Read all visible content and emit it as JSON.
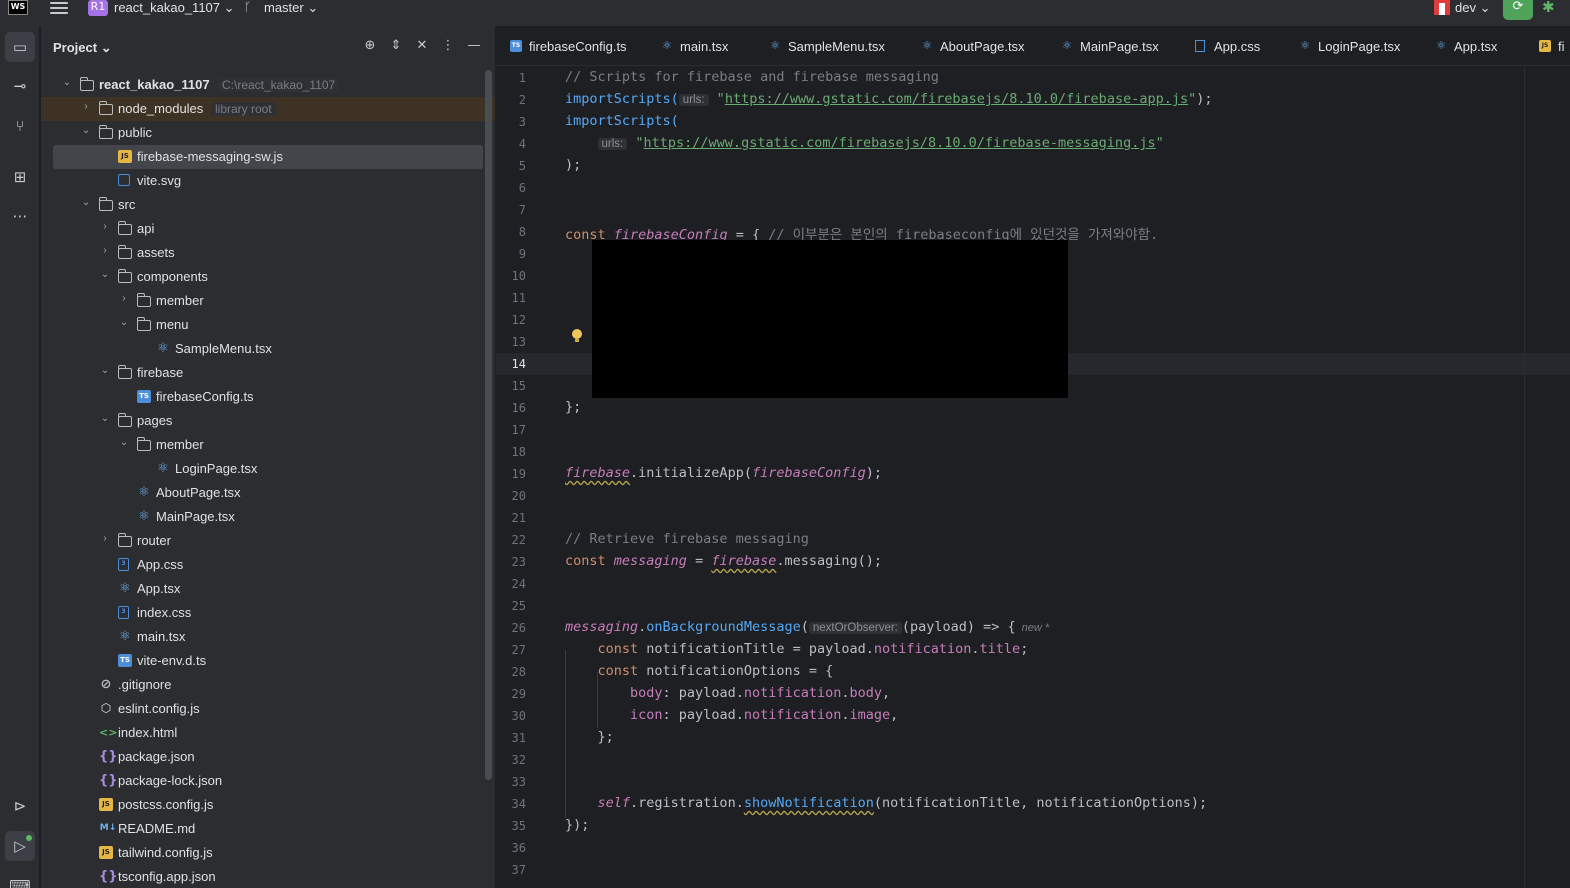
{
  "topbar": {
    "app_icon": "WS",
    "project_badge": "R1",
    "project_name": "react_kakao_1107",
    "branch": "master",
    "run_config": "dev",
    "icons": {
      "menu": "hamburger-icon",
      "branch": "git-branch-icon",
      "run": "run-icon",
      "debug": "debug-icon"
    }
  },
  "toolstrip": {
    "items": [
      "folder-icon",
      "commit-icon",
      "pull-request-icon",
      "structure-icon",
      "more-icon",
      "services-icon",
      "run-icon",
      "terminal-icon"
    ]
  },
  "project_panel": {
    "title": "Project",
    "header_icons": [
      "locate-icon",
      "expand-all-icon",
      "collapse-all-icon",
      "options-icon",
      "hide-icon"
    ],
    "tree": [
      {
        "label": "react_kakao_1107",
        "hint": "C:\\react_kakao_1107",
        "type": "folder",
        "depth": 0,
        "expanded": true,
        "bold": true
      },
      {
        "label": "node_modules",
        "hint": "library root",
        "type": "folder",
        "depth": 1,
        "expanded": false,
        "highlight": "nm"
      },
      {
        "label": "public",
        "type": "folder",
        "depth": 1,
        "expanded": true
      },
      {
        "label": "firebase-messaging-sw.js",
        "type": "js",
        "depth": 2,
        "highlight": "sel"
      },
      {
        "label": "vite.svg",
        "type": "svg",
        "depth": 2
      },
      {
        "label": "src",
        "type": "folder",
        "depth": 1,
        "expanded": true
      },
      {
        "label": "api",
        "type": "folder",
        "depth": 2,
        "expanded": false
      },
      {
        "label": "assets",
        "type": "folder",
        "depth": 2,
        "expanded": false
      },
      {
        "label": "components",
        "type": "folder",
        "depth": 2,
        "expanded": true
      },
      {
        "label": "member",
        "type": "folder",
        "depth": 3,
        "expanded": false
      },
      {
        "label": "menu",
        "type": "folder",
        "depth": 3,
        "expanded": true
      },
      {
        "label": "SampleMenu.tsx",
        "type": "react",
        "depth": 4
      },
      {
        "label": "firebase",
        "type": "folder",
        "depth": 2,
        "expanded": true
      },
      {
        "label": "firebaseConfig.ts",
        "type": "ts",
        "depth": 3
      },
      {
        "label": "pages",
        "type": "folder",
        "depth": 2,
        "expanded": true
      },
      {
        "label": "member",
        "type": "folder",
        "depth": 3,
        "expanded": true
      },
      {
        "label": "LoginPage.tsx",
        "type": "react",
        "depth": 4
      },
      {
        "label": "AboutPage.tsx",
        "type": "react",
        "depth": 3
      },
      {
        "label": "MainPage.tsx",
        "type": "react",
        "depth": 3
      },
      {
        "label": "router",
        "type": "folder",
        "depth": 2,
        "expanded": false
      },
      {
        "label": "App.css",
        "type": "css",
        "depth": 2
      },
      {
        "label": "App.tsx",
        "type": "react",
        "depth": 2
      },
      {
        "label": "index.css",
        "type": "css",
        "depth": 2
      },
      {
        "label": "main.tsx",
        "type": "react",
        "depth": 2
      },
      {
        "label": "vite-env.d.ts",
        "type": "ts",
        "depth": 2
      },
      {
        "label": ".gitignore",
        "type": "gitignore",
        "depth": 1
      },
      {
        "label": "eslint.config.js",
        "type": "eslint",
        "depth": 1
      },
      {
        "label": "index.html",
        "type": "html",
        "depth": 1
      },
      {
        "label": "package.json",
        "type": "json",
        "depth": 1
      },
      {
        "label": "package-lock.json",
        "type": "json",
        "depth": 1
      },
      {
        "label": "postcss.config.js",
        "type": "js",
        "depth": 1
      },
      {
        "label": "README.md",
        "type": "md",
        "depth": 1
      },
      {
        "label": "tailwind.config.js",
        "type": "js",
        "depth": 1
      },
      {
        "label": "tsconfig.app.json",
        "type": "json",
        "depth": 1
      }
    ]
  },
  "editor": {
    "tabs": [
      {
        "label": "firebaseConfig.ts",
        "type": "ts"
      },
      {
        "label": "main.tsx",
        "type": "react"
      },
      {
        "label": "SampleMenu.tsx",
        "type": "react"
      },
      {
        "label": "AboutPage.tsx",
        "type": "react"
      },
      {
        "label": "MainPage.tsx",
        "type": "react"
      },
      {
        "label": "App.css",
        "type": "css"
      },
      {
        "label": "LoginPage.tsx",
        "type": "react"
      },
      {
        "label": "App.tsx",
        "type": "react"
      },
      {
        "label": "fi",
        "type": "js",
        "active": true
      }
    ],
    "current_line": 14,
    "line_count": 37,
    "lines": {
      "1": "// Scripts for firebase and firebase messaging",
      "2a": "importScripts(",
      "2hint": "urls:",
      "2url": "https://www.gstatic.com/firebasejs/8.10.0/firebase-app.js",
      "3": "importScripts(",
      "4hint": "urls:",
      "4url": "https://www.gstatic.com/firebasejs/8.10.0/firebase-messaging.js",
      "5": ");",
      "8kw": "const",
      "8var": "firebaseConfig",
      "8op": " = { ",
      "8cmt1": "// 이부분은 본인의 ",
      "8cmt2": "firebaseconfig",
      "8cmt3": "에 있던것을 가져와야함.",
      "16": "};",
      "19obj": "firebase",
      "19fn": ".initializeApp(",
      "19arg": "firebaseConfig",
      "19end": ");",
      "22": "// Retrieve firebase messaging",
      "23kw": "const",
      "23var": "messaging",
      "23op": " = ",
      "23obj": "firebase",
      "23end": ".messaging();",
      "26obj": "messaging",
      "26fn": "onBackgroundMessage",
      "26hint": "nextOrObserver:",
      "26rest": "(payload) => {",
      "26new": "new *",
      "27kw": "const",
      "27a": " notificationTitle = payload.",
      "27f1": "notification",
      "27b": ".",
      "27f2": "title",
      "27c": ";",
      "28kw": "const",
      "28a": " notificationOptions = {",
      "29f": "body",
      "29a": ": payload.",
      "29f1": "notification",
      "29b": ".",
      "29f2": "body",
      "29c": ",",
      "30f": "icon",
      "30a": ": payload.",
      "30f1": "notification",
      "30b": ".",
      "30f2": "image",
      "30c": ",",
      "31": "};",
      "34self": "self",
      "34a": ".registration.",
      "34fn": "showNotification",
      "34b": "(notificationTitle, notificationOptions);",
      "35": "});"
    }
  }
}
